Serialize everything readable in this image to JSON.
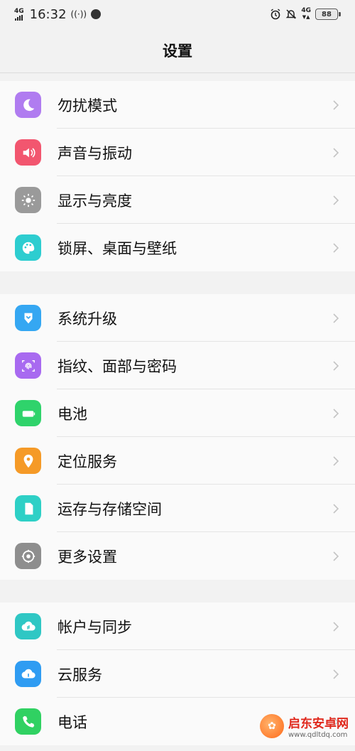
{
  "status_bar": {
    "network_left": "4G",
    "time": "16:32",
    "network_right": "4G",
    "battery": "88"
  },
  "title": "设置",
  "groups": [
    {
      "items": [
        {
          "label": "勿扰模式",
          "icon": "moon-icon",
          "color": "#b07cf0"
        },
        {
          "label": "声音与振动",
          "icon": "speaker-icon",
          "color": "#f2566f"
        },
        {
          "label": "显示与亮度",
          "icon": "sun-icon",
          "color": "#9a9a9a"
        },
        {
          "label": "锁屏、桌面与壁纸",
          "icon": "palette-icon",
          "color": "#2dcdd0"
        }
      ]
    },
    {
      "items": [
        {
          "label": "系统升级",
          "icon": "update-icon",
          "color": "#35a7f2"
        },
        {
          "label": "指纹、面部与密码",
          "icon": "fingerprint-icon",
          "color": "#a86af0"
        },
        {
          "label": "电池",
          "icon": "battery-icon",
          "color": "#2fd36b"
        },
        {
          "label": "定位服务",
          "icon": "location-pin-icon",
          "color": "#f59a27"
        },
        {
          "label": "运存与存储空间",
          "icon": "sd-card-icon",
          "color": "#2ed0c6"
        },
        {
          "label": "更多设置",
          "icon": "gear-icon",
          "color": "#8e8e8e"
        }
      ]
    },
    {
      "items": [
        {
          "label": "帐户与同步",
          "icon": "sync-icon",
          "color": "#2fc7c4"
        },
        {
          "label": "云服务",
          "icon": "cloud-icon",
          "color": "#2f9cf2"
        },
        {
          "label": "电话",
          "icon": "phone-icon",
          "color": "#30d162"
        }
      ]
    }
  ],
  "watermark": {
    "title": "启东安卓网",
    "url": "www.qdltdq.com"
  }
}
